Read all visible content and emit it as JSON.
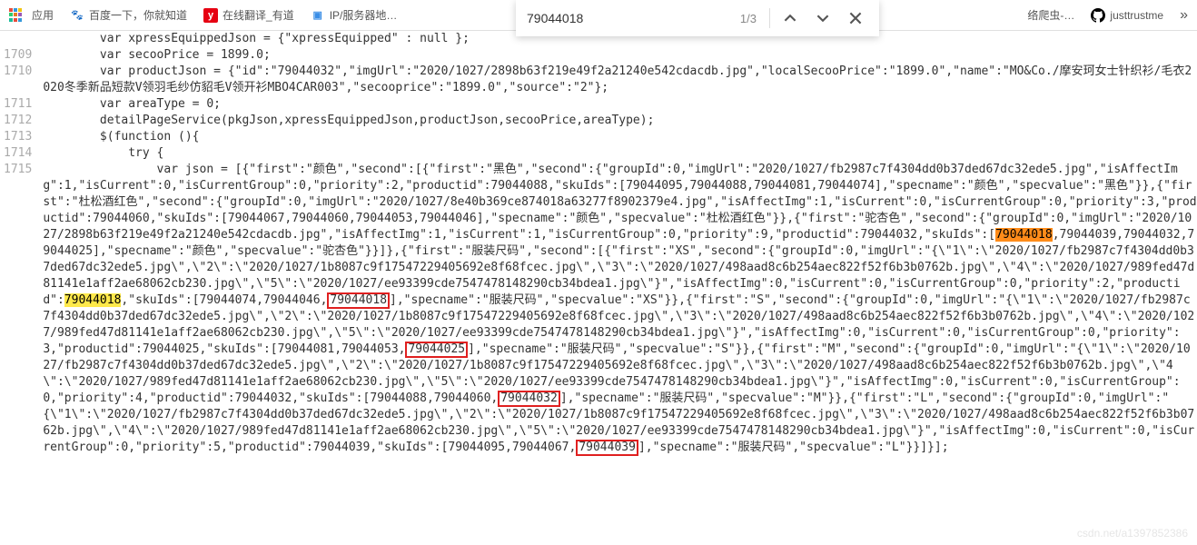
{
  "bookmarks": {
    "apps": "应用",
    "items": [
      {
        "label": "百度一下，你就知道",
        "icon": "paw",
        "iconColor": "#2a5dd1"
      },
      {
        "label": "在线翻译_有道",
        "icon": "y",
        "iconColor": "#e60012"
      },
      {
        "label": "IP/服务器地…",
        "icon": "box",
        "iconColor": "#3a8ee6"
      },
      {
        "label": "络爬虫-…",
        "icon": "",
        "iconColor": ""
      },
      {
        "label": "justtrustme",
        "icon": "gh",
        "iconColor": "#000"
      }
    ]
  },
  "find": {
    "value": "79044018",
    "count": "1/3"
  },
  "gutter": [
    "",
    "1709",
    "1710",
    "",
    "1711",
    "1712",
    "1713",
    "1714",
    "1715"
  ],
  "code": {
    "l1": "        var xpressEquippedJson = {\"xpressEquipped\" : null };",
    "l2": "        var secooPrice = 1899.0;",
    "l3": "        var productJson = {\"id\":\"79044032\",\"imgUrl\":\"2020/1027/2898b63f219e49f2a21240e542cdacdb.jpg\",\"localSecooPrice\":\"1899.0\",\"name\":\"MO&Co./摩安珂女士针织衫/毛衣2020冬季新品短款V领羽毛纱仿貂毛V领开衫MBO4CAR003\",\"secooprice\":\"1899.0\",\"source\":\"2\"};",
    "l4": "        var areaType = 0;",
    "l5": "        detailPageService(pkgJson,xpressEquippedJson,productJson,secooPrice,areaType);",
    "l6": "        $(function (){",
    "l7": "            try {",
    "l8_a": "                var json = [{\"first\":\"颜色\",\"second\":[{\"first\":\"黑色\",\"second\":{\"groupId\":0,\"imgUrl\":\"2020/1027/fb2987c7f4304dd0b37ded67dc32ede5.jpg\",\"isAffectImg\":1,\"isCurrent\":0,\"isCurrentGroup\":0,\"priority\":2,\"productid\":79044088,\"skuIds\":[79044095,79044088,79044081,79044074],\"specname\":\"颜色\",\"specvalue\":\"黑色\"}},{\"first\":\"杜松酒红色\",\"second\":{\"groupId\":0,\"imgUrl\":\"2020/1027/8e40b369ce874018a63277f8902379e4.jpg\",\"isAffectImg\":1,\"isCurrent\":0,\"isCurrentGroup\":0,\"priority\":3,\"productid\":79044060,\"skuIds\":[79044067,79044060,79044053,79044046],\"specname\":\"颜色\",\"specvalue\":\"杜松酒红色\"}},{\"first\":\"驼杏色\",\"second\":{\"groupId\":0,\"imgUrl\":\"2020/1027/2898b63f219e49f2a21240e542cdacdb.jpg\",\"isAffectImg\":1,\"isCurrent\":1,\"isCurrentGroup\":0,\"priority\":9,\"productid\":79044032,\"skuIds\":[",
    "l8_hl1": "79044018",
    "l8_b": ",79044039,79044032,79044025],\"specname\":\"颜色\",\"specvalue\":\"驼杏色\"}}]},{\"first\":\"服装尺码\",\"second\":[{\"first\":\"XS\",\"second\":{\"groupId\":0,\"imgUrl\":\"{\\\"1\\\":\\\"2020/1027/fb2987c7f4304dd0b37ded67dc32ede5.jpg\\\",\\\"2\\\":\\\"2020/1027/1b8087c9f17547229405692e8f68fcec.jpg\\\",\\\"3\\\":\\\"2020/1027/498aad8c6b254aec822f52f6b3b0762b.jpg\\\",\\\"4\\\":\\\"2020/1027/989fed47d81141e1aff2ae68062cb230.jpg\\\",\\\"5\\\":\\\"2020/1027/ee93399cde7547478148290cb34bdea1.jpg\\\"}\",\"isAffectImg\":0,\"isCurrent\":0,\"isCurrentGroup\":0,\"priority\":2,\"productid\":",
    "l8_hl2": "79044018",
    "l8_c": ",\"skuIds\":[79044074,79044046,",
    "l8_box1": "79044018",
    "l8_d": "],\"specname\":\"服装尺码\",\"specvalue\":\"XS\"}},{\"first\":\"S\",\"second\":{\"groupId\":0,\"imgUrl\":\"{\\\"1\\\":\\\"2020/1027/fb2987c7f4304dd0b37ded67dc32ede5.jpg\\\",\\\"2\\\":\\\"2020/1027/1b8087c9f17547229405692e8f68fcec.jpg\\\",\\\"3\\\":\\\"2020/1027/498aad8c6b254aec822f52f6b3b0762b.jpg\\\",\\\"4\\\":\\\"2020/1027/989fed47d81141e1aff2ae68062cb230.jpg\\\",\\\"5\\\":\\\"2020/1027/ee93399cde7547478148290cb34bdea1.jpg\\\"}\",\"isAffectImg\":0,\"isCurrent\":0,\"isCurrentGroup\":0,\"priority\":3,\"productid\":79044025,\"skuIds\":[79044081,79044053,",
    "l8_box2": "79044025",
    "l8_e": "],\"specname\":\"服装尺码\",\"specvalue\":\"S\"}},{\"first\":\"M\",\"second\":{\"groupId\":0,\"imgUrl\":\"{\\\"1\\\":\\\"2020/1027/fb2987c7f4304dd0b37ded67dc32ede5.jpg\\\",\\\"2\\\":\\\"2020/1027/1b8087c9f17547229405692e8f68fcec.jpg\\\",\\\"3\\\":\\\"2020/1027/498aad8c6b254aec822f52f6b3b0762b.jpg\\\",\\\"4\\\":\\\"2020/1027/989fed47d81141e1aff2ae68062cb230.jpg\\\",\\\"5\\\":\\\"2020/1027/ee93399cde7547478148290cb34bdea1.jpg\\\"}\",\"isAffectImg\":0,\"isCurrent\":0,\"isCurrentGroup\":0,\"priority\":4,\"productid\":79044032,\"skuIds\":[79044088,79044060,",
    "l8_box3": "79044032",
    "l8_f": "],\"specname\":\"服装尺码\",\"specvalue\":\"M\"}},{\"first\":\"L\",\"second\":{\"groupId\":0,\"imgUrl\":\"{\\\"1\\\":\\\"2020/1027/fb2987c7f4304dd0b37ded67dc32ede5.jpg\\\",\\\"2\\\":\\\"2020/1027/1b8087c9f17547229405692e8f68fcec.jpg\\\",\\\"3\\\":\\\"2020/1027/498aad8c6b254aec822f52f6b3b0762b.jpg\\\",\\\"4\\\":\\\"2020/1027/989fed47d81141e1aff2ae68062cb230.jpg\\\",\\\"5\\\":\\\"2020/1027/ee93399cde7547478148290cb34bdea1.jpg\\\"}\",\"isAffectImg\":0,\"isCurrent\":0,\"isCurrentGroup\":0,\"priority\":5,\"productid\":79044039,\"skuIds\":[79044095,79044067,",
    "l8_box4": "79044039",
    "l8_g": "],\"specname\":\"服装尺码\",\"specvalue\":\"L\"}}]}];"
  },
  "watermark": "csdn.net/a1397852386"
}
